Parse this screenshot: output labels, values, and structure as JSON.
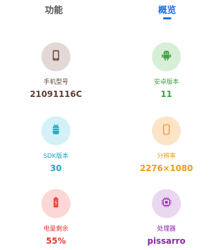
{
  "tabs": {
    "features": "功能",
    "overview": "概览"
  },
  "accent_color": "#1a73e8",
  "items": [
    {
      "label": "手机型号",
      "value": "21091116C",
      "icon": "phone-icon",
      "circle_color": "#e2d8d6",
      "icon_color": "#6d4c41",
      "text_color": "#5d4037"
    },
    {
      "label": "安卓版本",
      "value": "11",
      "icon": "android-icon",
      "circle_color": "#d7efd6",
      "icon_color": "#43a047",
      "text_color": "#43a047"
    },
    {
      "label": "SDK版本",
      "value": "30",
      "icon": "android-robot-icon",
      "circle_color": "#d3f1f7",
      "icon_color": "#26a7c6",
      "text_color": "#1fa5c4"
    },
    {
      "label": "分辨率",
      "value": "2276×1080",
      "icon": "screen-icon",
      "circle_color": "#fde4c8",
      "icon_color": "#ef9a1a",
      "text_color": "#f09a14"
    },
    {
      "label": "电量剩余",
      "value": "55%",
      "icon": "battery-icon",
      "circle_color": "#fcd7d5",
      "icon_color": "#e84a43",
      "text_color": "#e53935"
    },
    {
      "label": "处理器",
      "value": "pissarro",
      "icon": "chip-icon",
      "circle_color": "#ead8f0",
      "icon_color": "#9c27b0",
      "text_color": "#8e24aa"
    }
  ]
}
